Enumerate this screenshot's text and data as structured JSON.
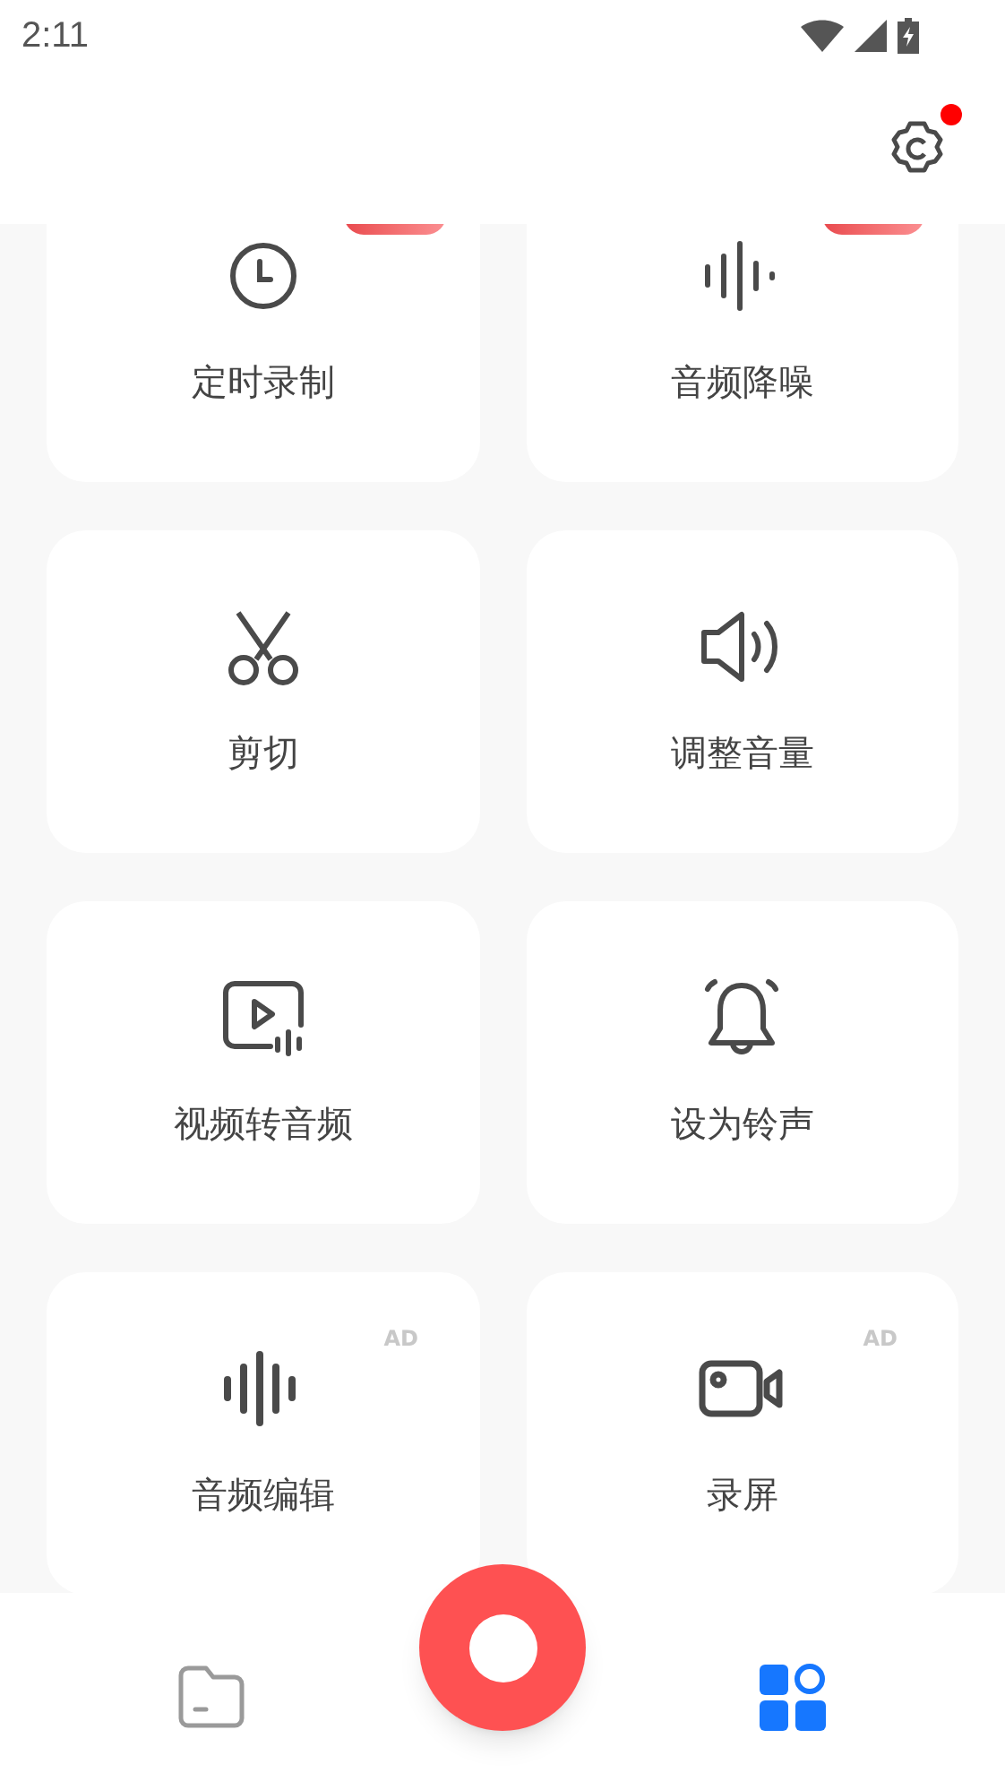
{
  "status_bar": {
    "time": "2:11"
  },
  "header": {
    "settings_notification": true
  },
  "tools": [
    {
      "label": "定时录制",
      "badge": true
    },
    {
      "label": "音频降噪",
      "badge": true
    },
    {
      "label": "剪切",
      "badge": false
    },
    {
      "label": "调整音量",
      "badge": false
    },
    {
      "label": "视频转音频",
      "badge": false
    },
    {
      "label": "设为铃声",
      "badge": false
    },
    {
      "label": "音频编辑",
      "badge": false,
      "ad": "AD"
    },
    {
      "label": "录屏",
      "badge": false,
      "ad": "AD"
    }
  ],
  "bottom_nav": [
    {
      "selected": false
    },
    {
      "selected": true
    }
  ]
}
